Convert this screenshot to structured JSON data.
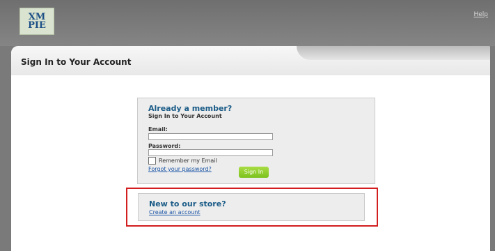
{
  "header": {
    "logo_text": [
      "XM",
      "PIE"
    ],
    "help_label": "Help"
  },
  "page": {
    "title": "Sign In to Your Account"
  },
  "login": {
    "heading": "Already a member?",
    "subheading": "Sign In to Your Account",
    "email_label": "Email:",
    "password_label": "Password:",
    "remember_label": "Remember my Email",
    "forgot_link": "Forgot your password?",
    "sign_in_button": "Sign In"
  },
  "new_customer": {
    "heading": "New to our store?",
    "create_account_link": "Create an account"
  }
}
